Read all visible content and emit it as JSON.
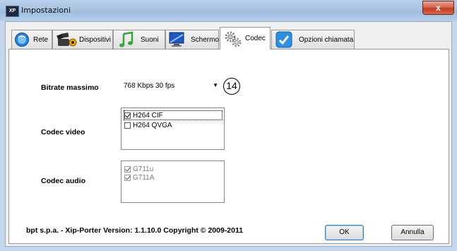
{
  "window": {
    "title": "Impostazioni",
    "app_icon_text": "XP",
    "close_glyph": "x"
  },
  "tabs": [
    {
      "label": "Rete",
      "icon": "globe-icon",
      "active": false
    },
    {
      "label": "Dispositivi",
      "icon": "video-camera-icon",
      "active": false
    },
    {
      "label": "Suoni",
      "icon": "music-note-icon",
      "active": false
    },
    {
      "label": "Schermo",
      "icon": "monitor-icon",
      "active": false
    },
    {
      "label": "Codec",
      "icon": "gears-icon",
      "active": true
    },
    {
      "label": "Opzioni chiamata",
      "icon": "phone-check-icon",
      "active": false
    }
  ],
  "codec_page": {
    "bitrate_label": "Bitrate massimo",
    "bitrate_value": "768 Kbps  30 fps",
    "callout": "14",
    "video_label": "Codec video",
    "video_items": [
      {
        "label": "H264 CIF",
        "checked": true
      },
      {
        "label": "H264 QVGA",
        "checked": false
      }
    ],
    "audio_label": "Codec audio",
    "audio_items": [
      {
        "label": "G711u",
        "checked": true
      },
      {
        "label": "G711A",
        "checked": true
      }
    ]
  },
  "footer": {
    "text": "bpt s.p.a. - Xip-Porter   Version: 1.1.10.0   Copyright © 2009-2011"
  },
  "buttons": {
    "ok": "OK",
    "cancel": "Annulla"
  },
  "colors": {
    "titlebar": "#a9c4e2",
    "close_button": "#c23a20",
    "client_bg": "#f0f0f0"
  }
}
